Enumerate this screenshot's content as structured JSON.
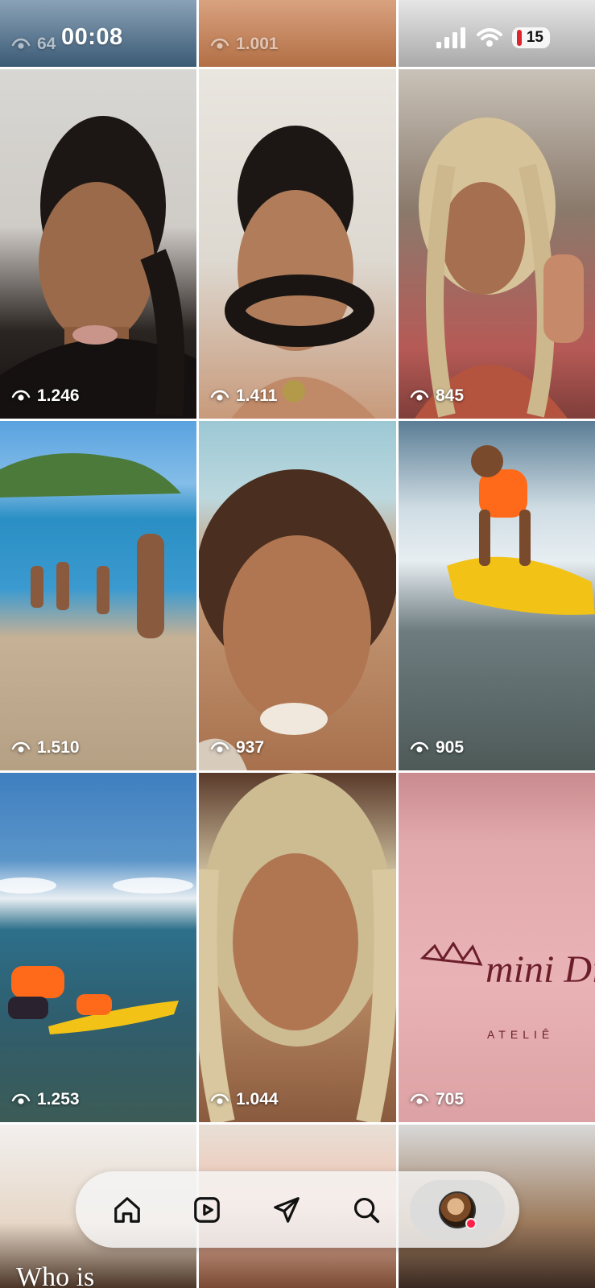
{
  "status_bar": {
    "time": "00:08",
    "battery": "15"
  },
  "top_row": [
    {
      "views": "64"
    },
    {
      "views": "1.001"
    },
    {
      "views": ""
    }
  ],
  "grid": [
    {
      "views": "1.246"
    },
    {
      "views": "1.411"
    },
    {
      "views": "845"
    },
    {
      "views": "1.510"
    },
    {
      "views": "937"
    },
    {
      "views": "905"
    },
    {
      "views": "1.253"
    },
    {
      "views": "1.044"
    },
    {
      "views": "705"
    }
  ],
  "overlays": {
    "mini_diva": "mini Diva",
    "atelie": "ATELIÊ",
    "who_is": "Who is"
  },
  "nav": [
    "home-icon",
    "reels-icon",
    "send-icon",
    "search-icon",
    "profile-avatar"
  ],
  "colors": {
    "accent_red": "#ff1f48"
  }
}
